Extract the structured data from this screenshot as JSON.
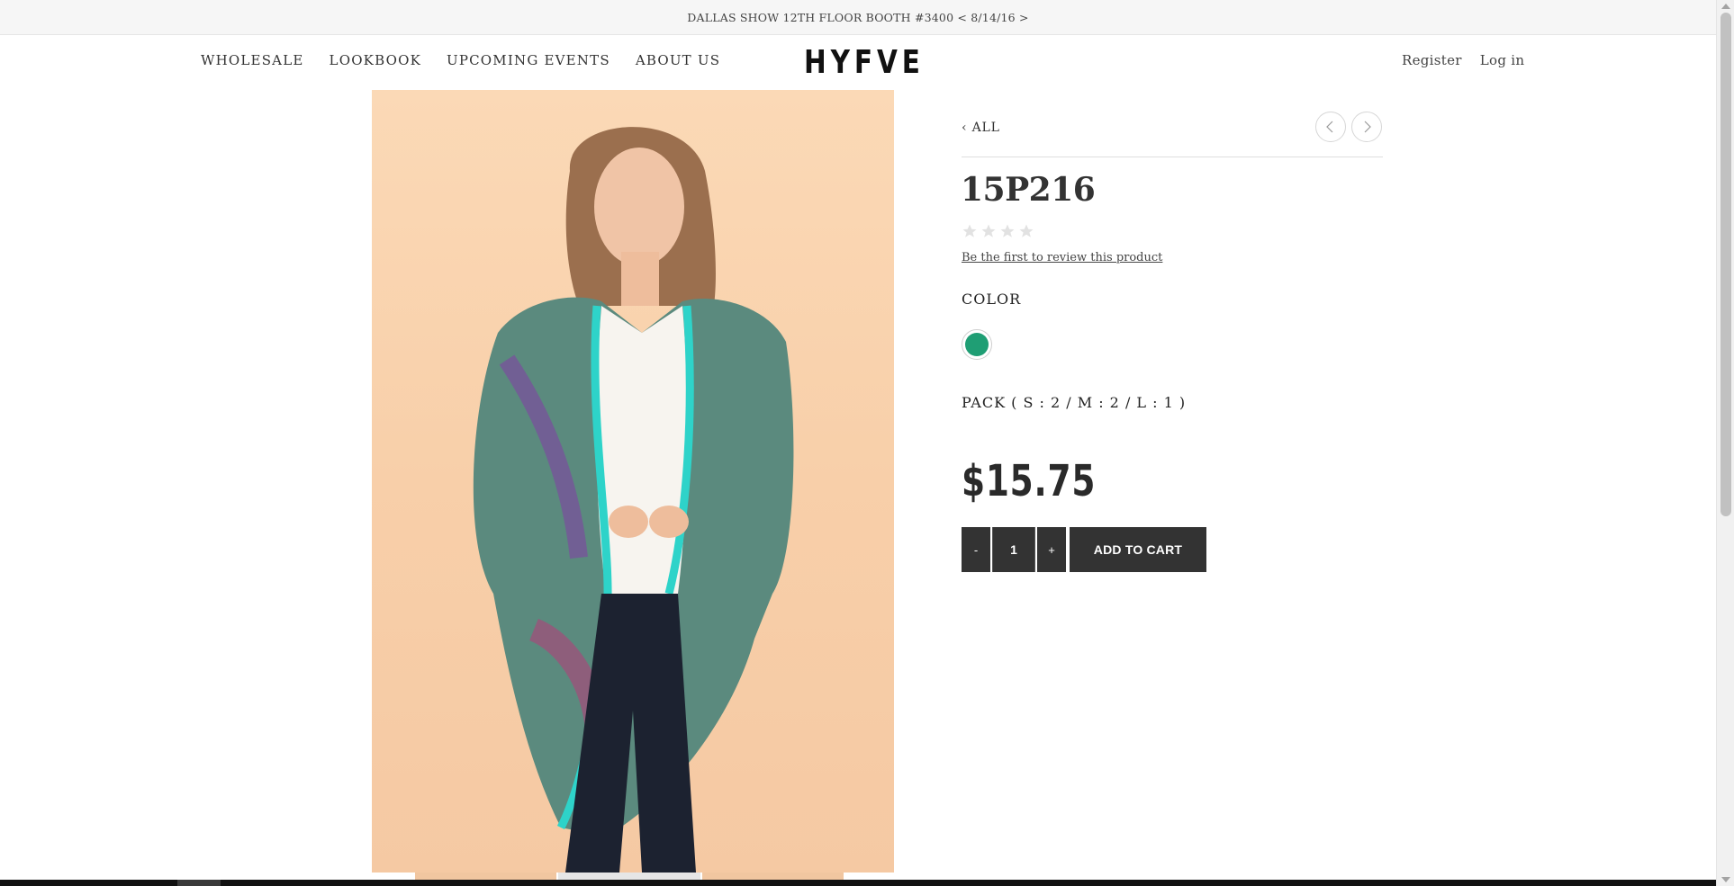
{
  "announcement": "DALLAS SHOW 12TH FLOOR BOOTH #3400 < 8/14/16 >",
  "nav": {
    "items": [
      {
        "label": "WHOLESALE"
      },
      {
        "label": "LOOKBOOK"
      },
      {
        "label": "UPCOMING EVENTS"
      },
      {
        "label": "ABOUT US"
      }
    ]
  },
  "logo": "HYFVE",
  "account": {
    "register": "Register",
    "login": "Log in"
  },
  "product": {
    "back_label": "‹ ALL",
    "title": "15P216",
    "rating_stars": 0,
    "rating_max": 5,
    "review_link": "Be the first to review this product",
    "color_label": "COLOR",
    "swatch_color": "#1f9e74",
    "pack": "PACK ( S : 2 / M : 2 / L : 1 )",
    "price": "$15.75",
    "qty_minus": "-",
    "qty_value": "1",
    "qty_plus": "+",
    "add_to_cart": "ADD TO CART",
    "image_icon": "product-photo-model-cardigan"
  },
  "colors": {
    "button_bg": "#333333",
    "page_bg": "#ffffff",
    "announce_bg": "#f6f6f6",
    "swatch": "#1f9e74"
  }
}
